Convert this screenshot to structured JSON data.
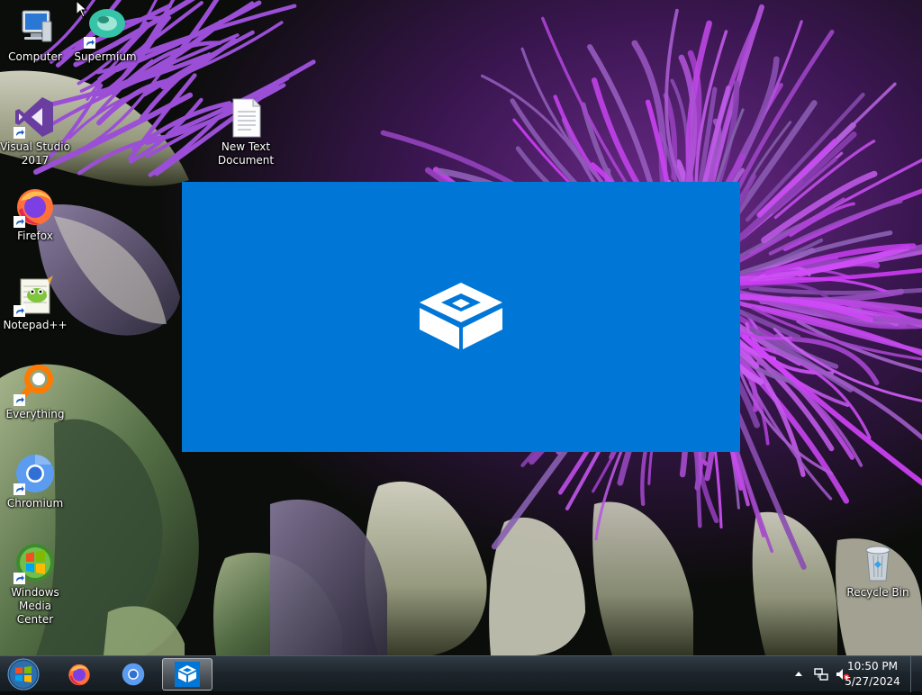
{
  "desktop": {
    "icons": [
      {
        "id": "computer",
        "label": "Computer"
      },
      {
        "id": "supermium",
        "label": "Supermium"
      },
      {
        "id": "visual-studio",
        "label": "Visual Studio 2017"
      },
      {
        "id": "new-text-document",
        "label": "New Text Document"
      },
      {
        "id": "firefox",
        "label": "Firefox"
      },
      {
        "id": "notepadpp",
        "label": "Notepad++"
      },
      {
        "id": "everything",
        "label": "Everything"
      },
      {
        "id": "chromium",
        "label": "Chromium"
      },
      {
        "id": "wmc",
        "label": "Windows Media Center"
      },
      {
        "id": "recycle-bin",
        "label": "Recycle Bin"
      }
    ]
  },
  "splash": {
    "background": "#0076d6",
    "logo_icon": "sandbox-box-icon"
  },
  "taskbar": {
    "start_icon": "windows-start-orb-icon",
    "pinned": [
      {
        "id": "firefox",
        "icon": "firefox-icon"
      },
      {
        "id": "chromium",
        "icon": "chromium-icon"
      },
      {
        "id": "sandbox",
        "icon": "sandbox-box-icon",
        "active": true
      }
    ],
    "tray": {
      "chevron_icon": "tray-show-hidden-icon",
      "network_icon": "network-icon",
      "volume_icon": "volume-muted-icon"
    },
    "clock": {
      "time": "10:50 PM",
      "date": "5/27/2024"
    }
  }
}
